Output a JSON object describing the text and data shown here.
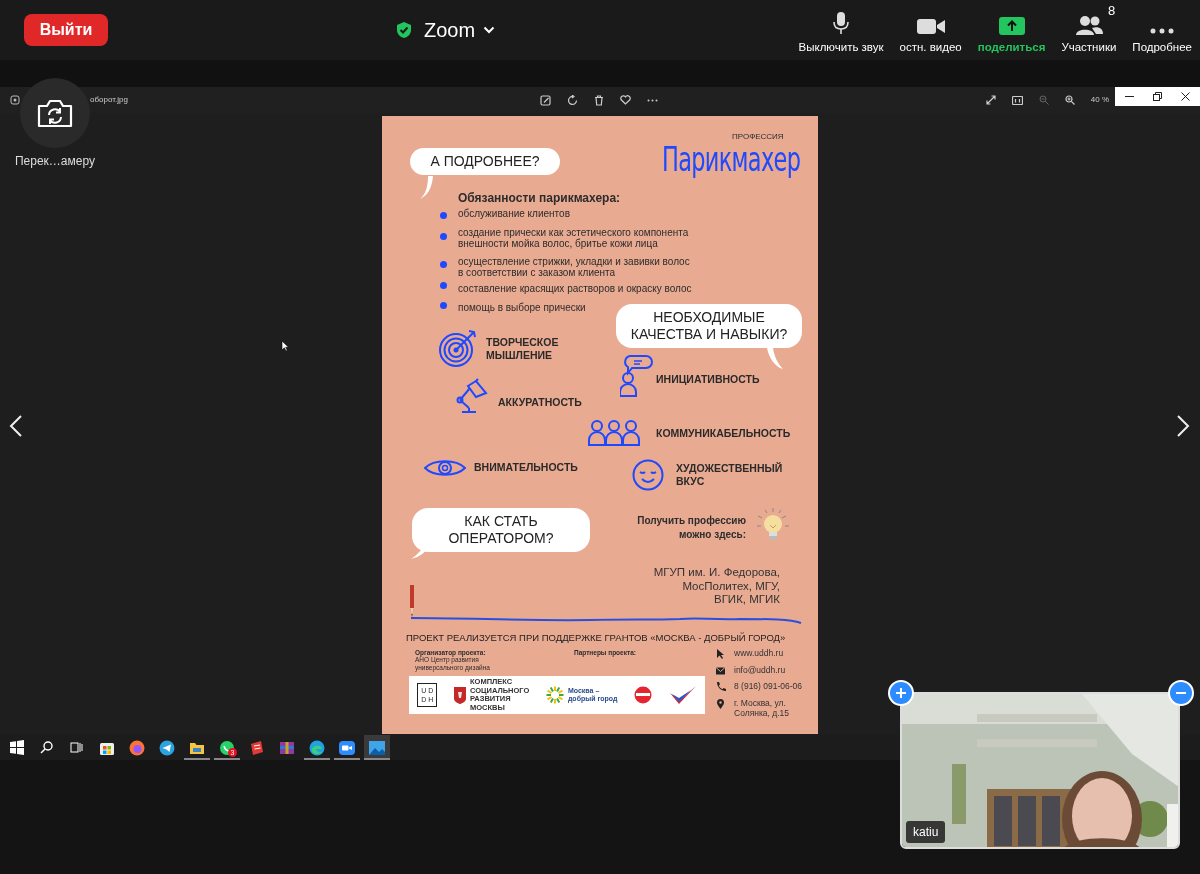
{
  "meeting_bar": {
    "leave_button": "Выйти",
    "title": "Zoom",
    "controls": [
      {
        "kind": "mic",
        "label": "Выключить звук"
      },
      {
        "kind": "video",
        "label": "остн. видео"
      },
      {
        "kind": "share",
        "label": "поделиться"
      },
      {
        "kind": "participants",
        "label": "Участники",
        "count": "8"
      },
      {
        "kind": "more",
        "label": "Подробнее"
      }
    ]
  },
  "camera_switch": {
    "label": "Перек…амеру"
  },
  "viewer": {
    "file_name": "оборот.jpg",
    "zoom": "40 %"
  },
  "poster": {
    "profession_label": "ПРОФЕССИЯ",
    "profession": "Парикмахер",
    "question_1": [
      "А ПОДРОБНЕЕ?"
    ],
    "duties_title": "Обязанности парикмахера:",
    "duties": [
      [
        "обслуживание клиентов"
      ],
      [
        "создание прически как эстетического компонента",
        "внешности мойка волос, бритье кожи лица"
      ],
      [
        "осуществление стрижки, укладки и завивки волос",
        "в соответствии с заказом клиента"
      ],
      [
        "составление красящих растворов и окраску волос"
      ],
      [
        "помощь в выборе прически"
      ]
    ],
    "question_2": [
      "НЕОБХОДИМЫЕ",
      "КАЧЕСТВА И НАВЫКИ?"
    ],
    "skills": [
      {
        "kind": "target",
        "lines": [
          "ТВОРЧЕСКОЕ",
          "МЫШЛЕНИЕ"
        ]
      },
      {
        "kind": "lamp",
        "lines": [
          "АККУРАТНОСТЬ"
        ]
      },
      {
        "kind": "person-speech",
        "lines": [
          "ИНИЦИАТИВНОСТЬ"
        ]
      },
      {
        "kind": "group",
        "lines": [
          "КОММУНИКАБЕЛЬНОСТЬ"
        ]
      },
      {
        "kind": "eye",
        "lines": [
          "ВНИМАТЕЛЬНОСТЬ"
        ]
      },
      {
        "kind": "smile",
        "lines": [
          "ХУДОЖЕСТВЕННЫЙ",
          "ВКУС"
        ]
      }
    ],
    "question_3": [
      "КАК СТАТЬ",
      "ОПЕРАТОРОМ?"
    ],
    "where_title": [
      "Получить профессию",
      "можно здесь:"
    ],
    "institutions": [
      "МГУП им. И. Федорова,",
      "МосПолитех, МГУ,",
      "ВГИК, МГИК"
    ],
    "project_note": "ПРОЕКТ РЕАЛИЗУЕТСЯ ПРИ ПОДДЕРЖКЕ ГРАНТОВ «МОСКВА - ДОБРЫЙ ГОРОД»",
    "organizer_title": "Организатор проекта:",
    "organizer": [
      "АНО Центр развития",
      "универсального дизайна"
    ],
    "partners_title": "Партнеры проекта:",
    "logos": [
      {
        "kind": "uddh",
        "lines": [
          "U D",
          "D H"
        ]
      },
      {
        "kind": "emblem",
        "lines": [
          "КОМПЛЕКС",
          "СОЦИАЛЬНОГО",
          "РАЗВИТИЯ",
          "МОСКВЫ"
        ]
      },
      {
        "kind": "sun",
        "lines": [
          "Москва –",
          "добрый город"
        ]
      },
      {
        "kind": "red-circle"
      },
      {
        "kind": "tick"
      }
    ],
    "contacts": [
      {
        "kind": "web",
        "lines": [
          "www.uddh.ru"
        ]
      },
      {
        "kind": "mail",
        "lines": [
          "info@uddh.ru"
        ]
      },
      {
        "kind": "phone",
        "lines": [
          "8 (916) 091-06-06"
        ]
      },
      {
        "kind": "pin",
        "lines": [
          "г. Москва, ул.",
          "Солянка, д.15"
        ]
      }
    ]
  },
  "taskbar": {
    "apps": [
      {
        "kind": "windows",
        "running": false,
        "selected": false
      },
      {
        "kind": "search",
        "running": false,
        "selected": false
      },
      {
        "kind": "task-view",
        "running": false,
        "selected": false
      },
      {
        "kind": "store",
        "running": false,
        "selected": false
      },
      {
        "kind": "firefox",
        "running": false,
        "selected": false
      },
      {
        "kind": "telegram",
        "running": false,
        "selected": false
      },
      {
        "kind": "folder",
        "running": true,
        "selected": false
      },
      {
        "kind": "whatsapp",
        "running": true,
        "selected": false,
        "badge": "3"
      },
      {
        "kind": "red-app",
        "running": false,
        "selected": false
      },
      {
        "kind": "archive",
        "running": false,
        "selected": false
      },
      {
        "kind": "edge",
        "running": true,
        "selected": false
      },
      {
        "kind": "zoom",
        "running": true,
        "selected": false
      },
      {
        "kind": "photos",
        "running": true,
        "selected": true
      }
    ]
  },
  "video": {
    "name": "katiu"
  }
}
